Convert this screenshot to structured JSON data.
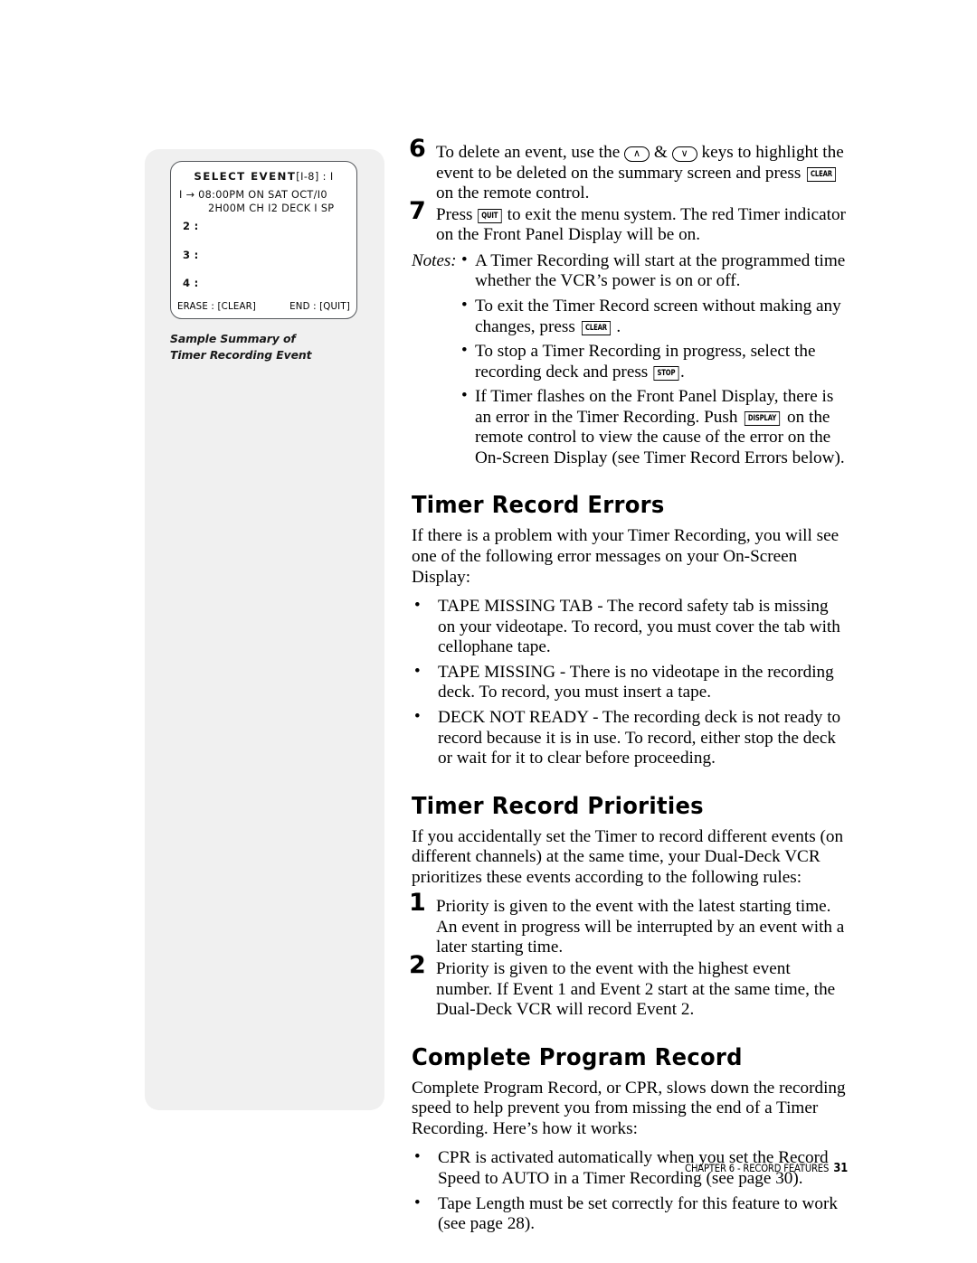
{
  "sidebar": {
    "osd": {
      "title_main": "SELECT EVENT",
      "title_range": "[I-8] : I",
      "event1_line1": "I →  08:00PM  ON  SAT  OCT/I0",
      "event1_line2": "2H00M  CH I2  DECK I  SP",
      "slot2": "2 :",
      "slot3": "3 :",
      "slot4": "4 :",
      "footer_left": "ERASE : [CLEAR]",
      "footer_right": "END : [QUIT]"
    },
    "caption_line1": "Sample Summary of",
    "caption_line2": "Timer Recording Event"
  },
  "content": {
    "step6": {
      "number": "6",
      "t1": "To delete an event, use the ",
      "key_up": "∧",
      "t2": " & ",
      "key_down": "∨",
      "t3": " keys to highlight the event to be deleted on the summary screen and press ",
      "key_clear": "CLEAR",
      "t4": " on the remote control."
    },
    "step7": {
      "number": "7",
      "t1": "Press ",
      "key_quit": "QUIT",
      "t2": " to exit the menu system. The red Timer indicator on the Front Panel Display will be on."
    },
    "notes": {
      "label": "Notes:",
      "bullet": "•",
      "items": [
        {
          "t1": "A Timer Recording will start at the programmed time whether the VCR’s power is on or off."
        },
        {
          "t1": "To exit the Timer Record screen without making any changes, press ",
          "key": "CLEAR",
          "t2": " ."
        },
        {
          "t1": "To stop a Timer Recording in progress, select the recording deck and press ",
          "key": "STOP",
          "t2": "."
        },
        {
          "t1": "If Timer flashes on the Front Panel Display, there is an error in the Timer Recording. Push ",
          "key": "DISPLAY",
          "t2": " on the remote control to view the cause of the error on the On-Screen Display (see Timer Record Errors below)."
        }
      ]
    },
    "errors_section": {
      "heading": "Timer Record Errors",
      "intro": "If there is a problem with your Timer Recording, you will see one of the following error messages on your On-Screen Display:",
      "bullet": "•",
      "items": [
        "TAPE MISSING TAB - The record safety tab is missing on your videotape. To record, you must cover the tab with cellophane tape.",
        "TAPE MISSING - There is no videotape in the recording deck. To record, you must insert a tape.",
        "DECK NOT READY - The recording deck is not ready to record because it is in use. To record, either stop the deck or wait for it to clear before proceeding."
      ]
    },
    "priorities_section": {
      "heading": "Timer Record Priorities",
      "intro": "If you accidentally set the Timer to record different events (on different channels) at the same time, your Dual-Deck VCR prioritizes these events according to the following rules:",
      "steps": [
        {
          "number": "1",
          "text": "Priority is given to the event with the latest starting time. An event in progress will be interrupted by an event with a later starting time."
        },
        {
          "number": "2",
          "text": "Priority is given to the event with the highest event number. If Event 1 and Event 2 start at the same time, the Dual-Deck VCR will record Event 2."
        }
      ]
    },
    "cpr_section": {
      "heading": "Complete Program Record",
      "intro": "Complete Program Record, or CPR, slows down the recording speed to help prevent you from missing the end of a Timer Recording. Here’s how it works:",
      "bullet": "•",
      "items": [
        "CPR is activated automatically when you set the Record Speed to AUTO in a Timer Recording (see page 30).",
        "Tape Length must be set correctly for this feature to work (see page 28)."
      ]
    }
  },
  "footer": {
    "chapter": "CHAPTER 6 - RECORD FEATURES",
    "page": "31"
  }
}
